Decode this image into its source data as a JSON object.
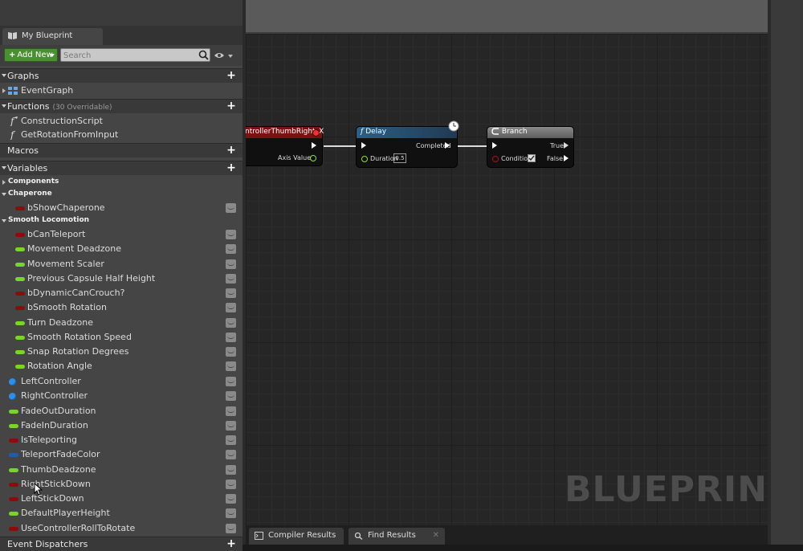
{
  "panel": {
    "tab_label": "My Blueprint",
    "add_new_label": "Add New",
    "search_placeholder": "Search"
  },
  "sections": {
    "graphs": {
      "label": "Graphs",
      "items": [
        "EventGraph"
      ]
    },
    "functions": {
      "label": "Functions",
      "sub": "(30 Overridable)",
      "items": [
        "ConstructionScript",
        "GetRotationFromInput"
      ]
    },
    "macros": {
      "label": "Macros"
    },
    "variables": {
      "label": "Variables"
    },
    "event_dispatchers": {
      "label": "Event Dispatchers"
    }
  },
  "categories": {
    "components": "Components",
    "chaperone": "Chaperone",
    "smooth_locomotion": "Smooth Locomotion"
  },
  "variables": {
    "chaperone": [
      {
        "name": "bShowChaperone",
        "type": "bool"
      }
    ],
    "smooth_locomotion": [
      {
        "name": "bCanTeleport",
        "type": "bool"
      },
      {
        "name": "Movement Deadzone",
        "type": "float"
      },
      {
        "name": "Movement Scaler",
        "type": "float"
      },
      {
        "name": "Previous Capsule Half Height",
        "type": "float"
      },
      {
        "name": "bDynamicCanCrouch?",
        "type": "bool"
      },
      {
        "name": "bSmooth Rotation",
        "type": "bool"
      },
      {
        "name": "Turn Deadzone",
        "type": "float"
      },
      {
        "name": "Smooth Rotation Speed",
        "type": "float"
      },
      {
        "name": "Snap Rotation Degrees",
        "type": "float"
      },
      {
        "name": "Rotation Angle",
        "type": "float"
      }
    ],
    "default": [
      {
        "name": "LeftController",
        "type": "object"
      },
      {
        "name": "RightController",
        "type": "object"
      },
      {
        "name": "FadeOutDuration",
        "type": "float"
      },
      {
        "name": "FadeInDuration",
        "type": "float"
      },
      {
        "name": "IsTeleporting",
        "type": "bool"
      },
      {
        "name": "TeleportFadeColor",
        "type": "linear"
      },
      {
        "name": "ThumbDeadzone",
        "type": "float"
      },
      {
        "name": "RightStickDown",
        "type": "bool"
      },
      {
        "name": "LeftStickDown",
        "type": "bool"
      },
      {
        "name": "DefaultPlayerHeight",
        "type": "float"
      },
      {
        "name": "UseControllerRollToRotate",
        "type": "bool"
      }
    ]
  },
  "graph": {
    "watermark": "BLUEPRINT",
    "nodes": {
      "axis": {
        "title": "ntrollerThumbRight_X",
        "out_label": "Axis Value"
      },
      "delay": {
        "title": "Delay",
        "duration_label": "Duration",
        "duration_value": "0.5",
        "completed_label": "Completed"
      },
      "branch": {
        "title": "Branch",
        "condition_label": "Condition",
        "true_label": "True",
        "false_label": "False"
      }
    }
  },
  "bottom_tabs": [
    "Compiler Results",
    "Find Results"
  ],
  "colors": {
    "bool_pin": "#8e0b0b",
    "float_pin": "#79d52b",
    "object_pin": "#2f8fe6",
    "linear_color_pin": "#1f5bb0",
    "add_new_green": "#4a8f31",
    "delay_header": "#2d5f86",
    "axis_header": "#7a1212"
  }
}
